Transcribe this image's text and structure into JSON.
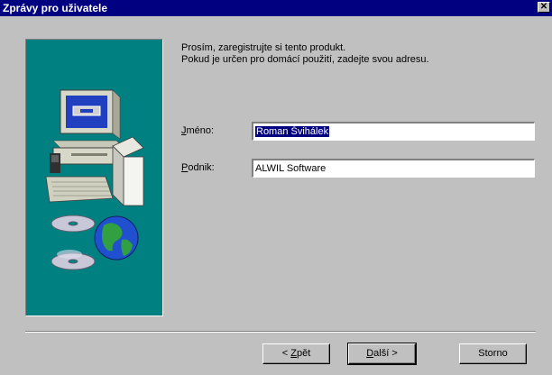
{
  "window": {
    "title": "Zprávy pro uživatele",
    "close_glyph": "✕"
  },
  "intro": {
    "line1": "Prosím, zaregistrujte si tento produkt.",
    "line2": "Pokud je určen pro domácí použití, zadejte svou adresu."
  },
  "form": {
    "name_label_underlined": "J",
    "name_label_rest": "méno:",
    "name_value": "Roman Švihálek",
    "company_label_underlined": "P",
    "company_label_rest": "odnik:",
    "company_value": "ALWIL Software"
  },
  "buttons": {
    "back_prefix": "< ",
    "back_underlined": "Z",
    "back_rest": "pět",
    "next_underlined": "D",
    "next_rest": "alší >",
    "cancel": "Storno"
  },
  "colors": {
    "title_bar": "#000080",
    "illustration_bg": "#008080",
    "dialog_bg": "#c0c0c0",
    "selection": "#000080"
  },
  "icons": {
    "illustration": "computer-with-cds-and-globe-icon",
    "close": "close-icon"
  }
}
